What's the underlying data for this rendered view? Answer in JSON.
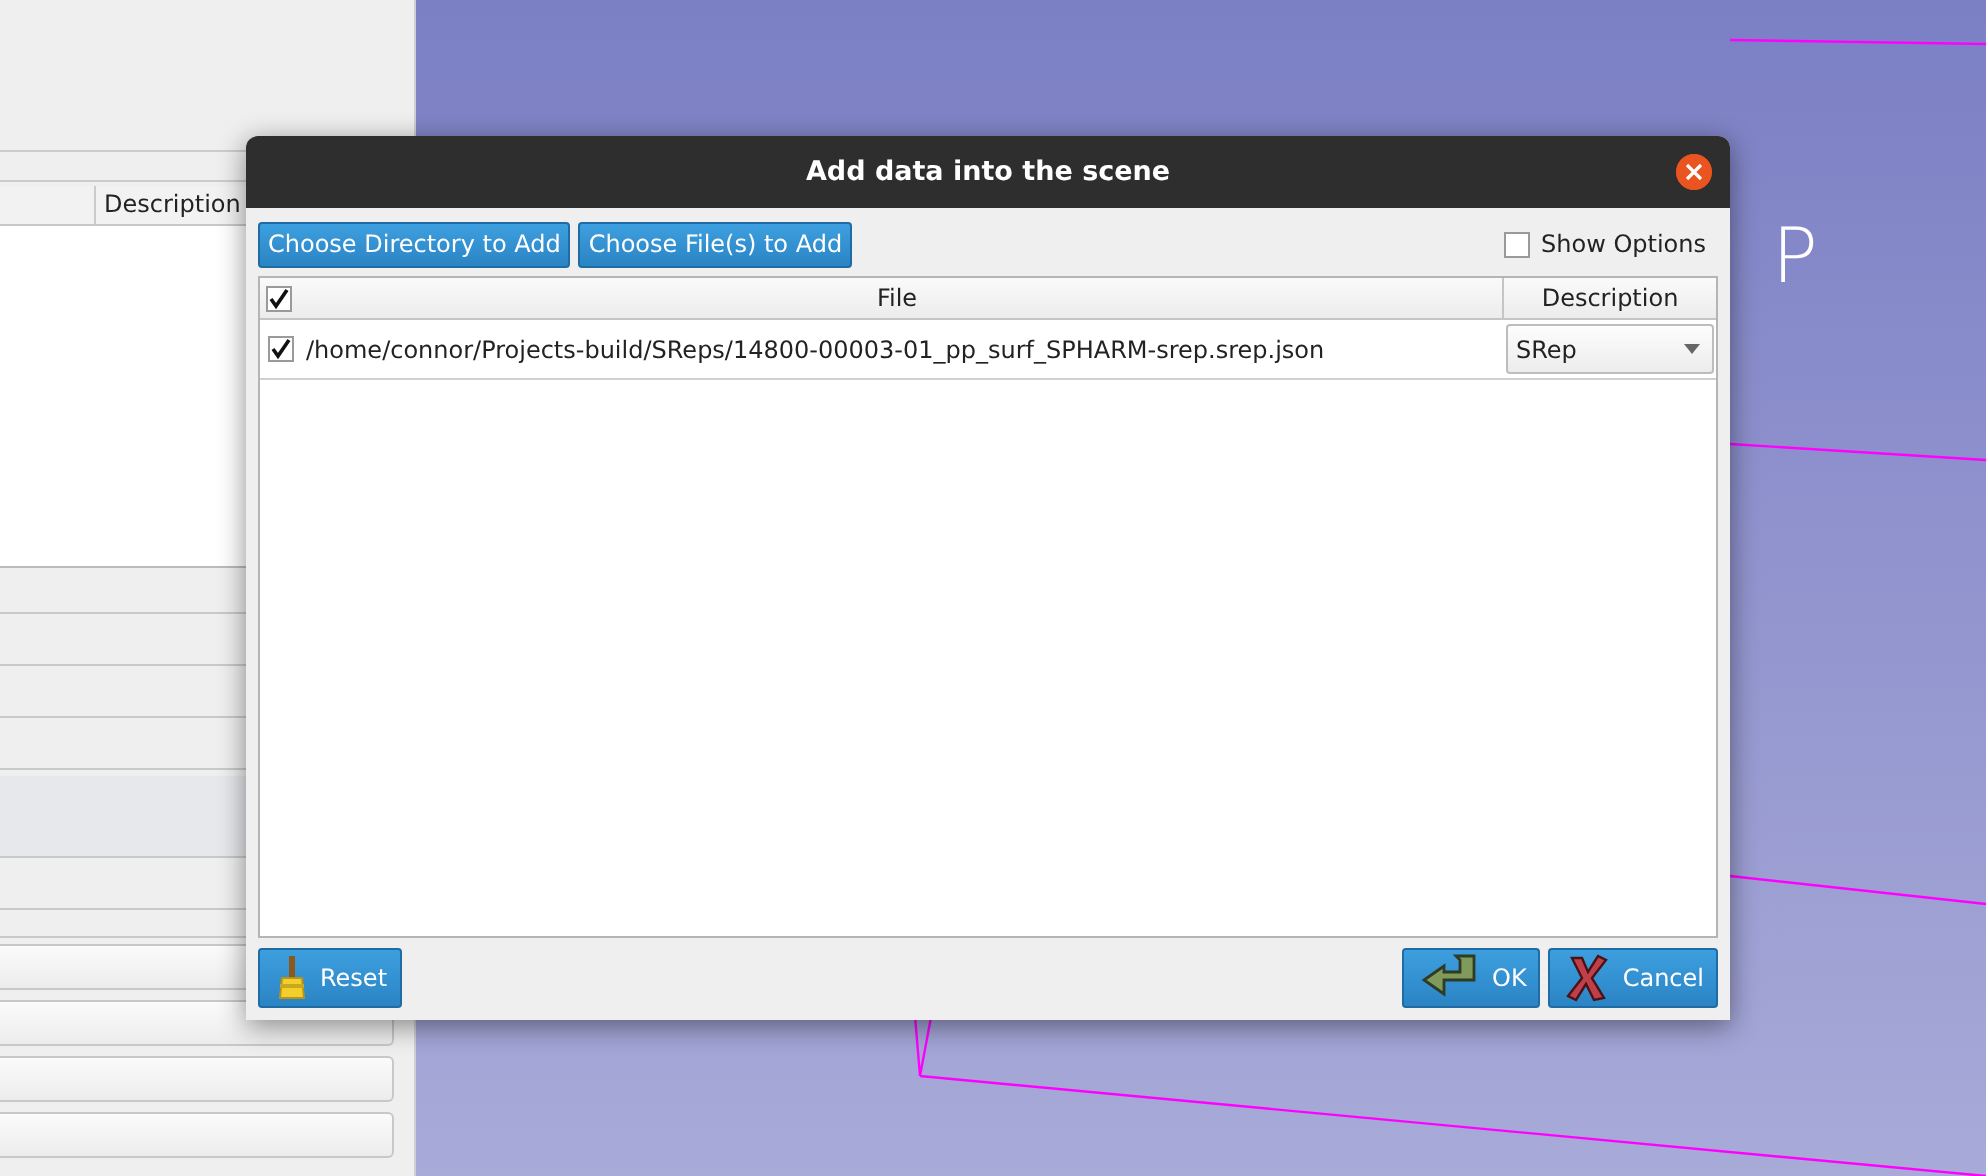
{
  "background": {
    "panel": {
      "columns": [
        {
          "label": "Description"
        }
      ]
    },
    "view": {
      "marker_label": "P"
    }
  },
  "dialog": {
    "title": "Add data into the scene",
    "toolbar": [
      {
        "label": "Choose Directory to Add"
      },
      {
        "label": "Choose File(s) to Add"
      }
    ],
    "show_options": {
      "label": "Show Options",
      "checked": false
    },
    "table": {
      "select_all_checked": true,
      "columns": [
        "File",
        "Description"
      ],
      "rows": [
        {
          "checked": true,
          "file": "/home/connor/Projects-build/SReps/14800-00003-01_pp_surf_SPHARM-srep.srep.json",
          "description": "SRep"
        }
      ]
    },
    "buttons": [
      {
        "kind": "reset",
        "label": "Reset"
      },
      {
        "kind": "ok",
        "label": "OK"
      },
      {
        "kind": "cancel",
        "label": "Cancel"
      }
    ]
  }
}
